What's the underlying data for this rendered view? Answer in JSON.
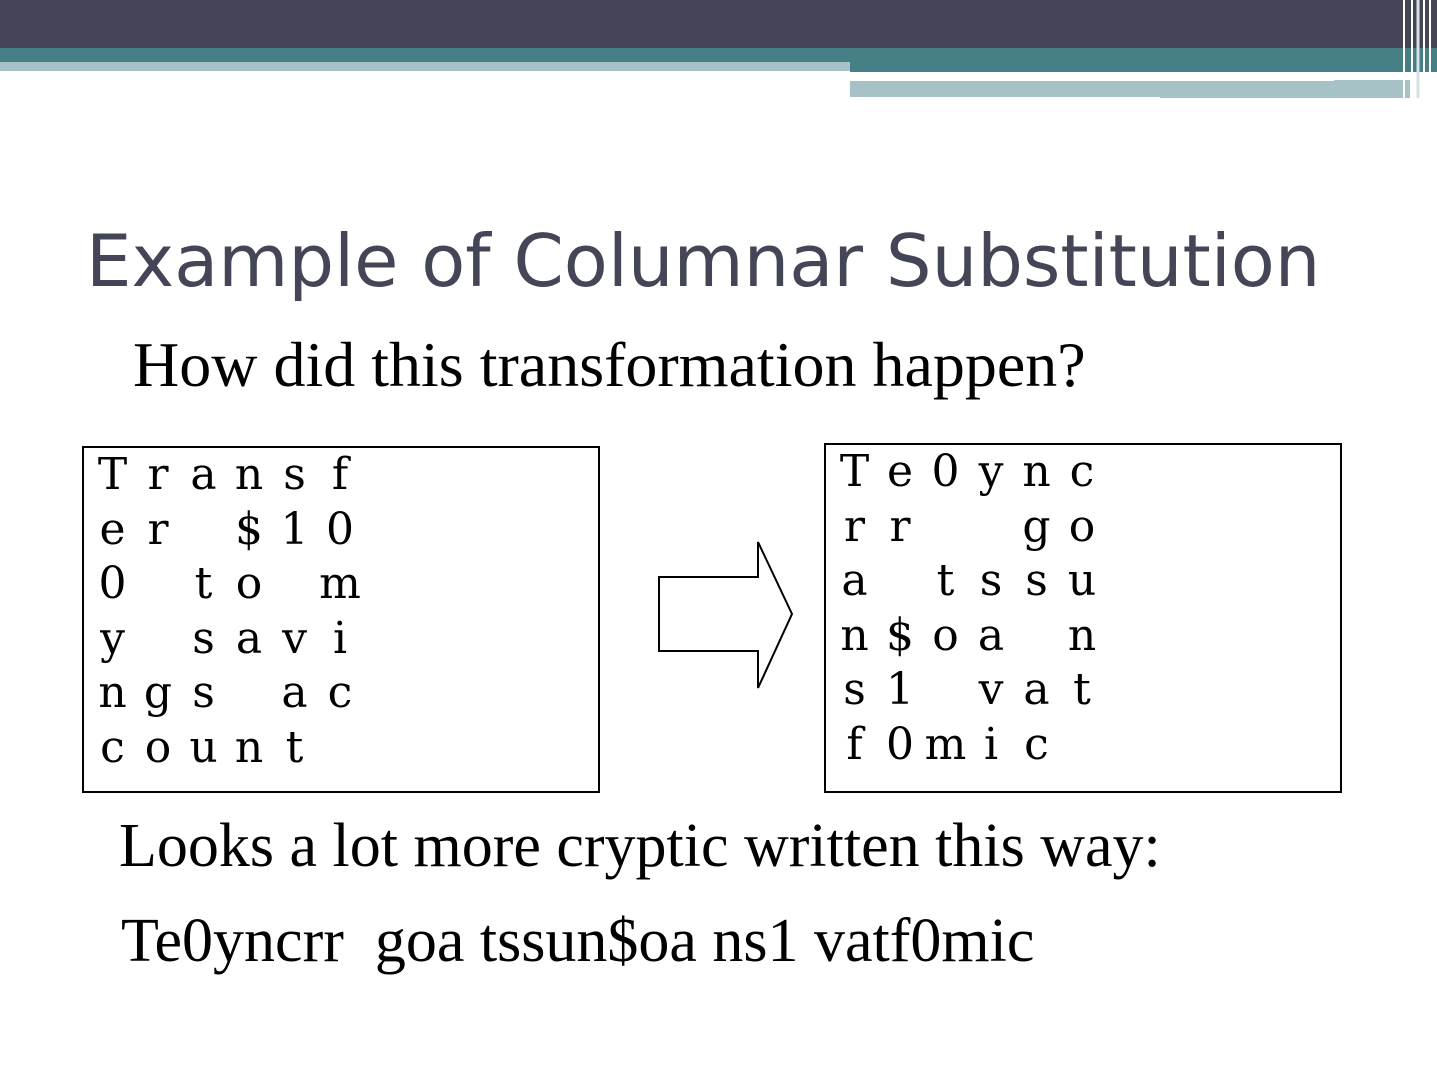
{
  "slide": {
    "title": "Example of Columnar Substitution",
    "subtitle": "How did this transformation happen?",
    "note": "Looks a lot more cryptic written this way:",
    "ciphertext": "Te0yncrr  goa tssun$oa ns1 vatf0mic"
  },
  "plaintext_grid": [
    [
      "T",
      "r",
      "a",
      "n",
      "s",
      "f"
    ],
    [
      "e",
      "r",
      " ",
      "$",
      "1",
      "0"
    ],
    [
      "0",
      " ",
      "t",
      "o",
      " ",
      "m"
    ],
    [
      "y",
      " ",
      "s",
      "a",
      "v",
      "i"
    ],
    [
      "n",
      "g",
      "s",
      " ",
      "a",
      "c"
    ],
    [
      "c",
      "o",
      "u",
      "n",
      "t",
      ""
    ]
  ],
  "ciphertext_grid": [
    [
      "T",
      "e",
      "0",
      "y",
      "n",
      "c"
    ],
    [
      "r",
      "r",
      " ",
      " ",
      "g",
      "o"
    ],
    [
      "a",
      " ",
      "t",
      "s",
      "s",
      "u"
    ],
    [
      "n",
      "$",
      "o",
      "a",
      " ",
      "n"
    ],
    [
      "s",
      "1",
      " ",
      "v",
      "a",
      "t"
    ],
    [
      "f",
      "0",
      "m",
      "i",
      "c",
      ""
    ]
  ],
  "colors": {
    "title": "#444657",
    "header_dark": "#444657",
    "header_teal": "#477f87",
    "header_light": "#a6c2c7"
  },
  "icons": {
    "arrow": "right-arrow-outline-icon"
  }
}
